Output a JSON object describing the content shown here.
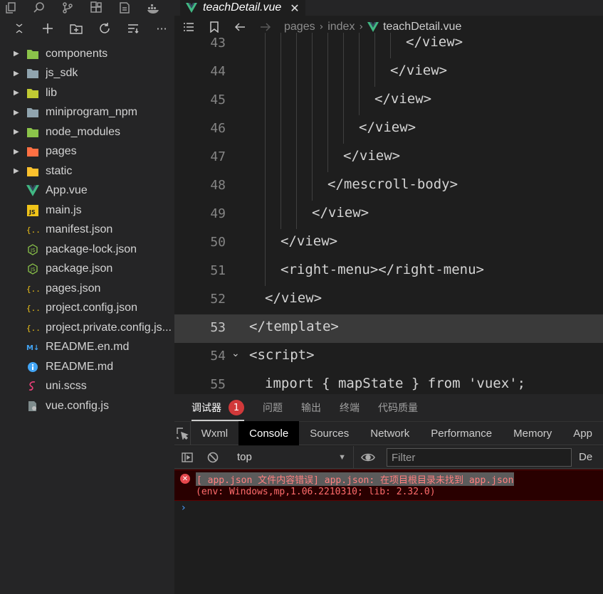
{
  "activity_bar": {
    "icons": [
      "files-icon",
      "search-icon",
      "source-control-icon",
      "extensions-icon",
      "page-icon",
      "docker-icon"
    ]
  },
  "explorer_toolbar": {
    "icons": [
      "collapse-icon",
      "new-file-icon",
      "new-folder-icon",
      "refresh-icon",
      "sort-icon",
      "more-icon"
    ],
    "more_label": "···"
  },
  "explorer": {
    "items": [
      {
        "label": "components",
        "type": "folder",
        "color": "#8bc34a"
      },
      {
        "label": "js_sdk",
        "type": "folder",
        "color": "#90a4ae"
      },
      {
        "label": "lib",
        "type": "folder",
        "color": "#c0ca33"
      },
      {
        "label": "miniprogram_npm",
        "type": "folder",
        "color": "#90a4ae"
      },
      {
        "label": "node_modules",
        "type": "folder",
        "color": "#8bc34a"
      },
      {
        "label": "pages",
        "type": "folder",
        "color": "#ff7043"
      },
      {
        "label": "static",
        "type": "folder",
        "color": "#fbc02d"
      },
      {
        "label": "App.vue",
        "type": "vue"
      },
      {
        "label": "main.js",
        "type": "js"
      },
      {
        "label": "manifest.json",
        "type": "json"
      },
      {
        "label": "package-lock.json",
        "type": "npm"
      },
      {
        "label": "package.json",
        "type": "npm"
      },
      {
        "label": "pages.json",
        "type": "json"
      },
      {
        "label": "project.config.json",
        "type": "json"
      },
      {
        "label": "project.private.config.js...",
        "type": "json"
      },
      {
        "label": "README.en.md",
        "type": "md"
      },
      {
        "label": "README.md",
        "type": "info"
      },
      {
        "label": "uni.scss",
        "type": "sass"
      },
      {
        "label": "vue.config.js",
        "type": "config"
      }
    ]
  },
  "tab": {
    "name": "teachDetail.vue",
    "close": "✕"
  },
  "breadcrumb": {
    "parts": [
      "pages",
      "index"
    ],
    "file": "teachDetail.vue",
    "sep": "›"
  },
  "code": {
    "lines": [
      {
        "num": "43",
        "text": "</view>",
        "indent": 10
      },
      {
        "num": "44",
        "text": "</view>",
        "indent": 9
      },
      {
        "num": "45",
        "text": "</view>",
        "indent": 8
      },
      {
        "num": "46",
        "text": "</view>",
        "indent": 7
      },
      {
        "num": "47",
        "text": "</view>",
        "indent": 6
      },
      {
        "num": "48",
        "text": "</mescroll-body>",
        "indent": 5
      },
      {
        "num": "49",
        "text": "</view>",
        "indent": 4
      },
      {
        "num": "50",
        "text": "</view>",
        "indent": 2
      },
      {
        "num": "51",
        "text": "<right-menu></right-menu>",
        "indent": 2
      },
      {
        "num": "52",
        "text": "</view>",
        "indent": 1
      },
      {
        "num": "53",
        "text": "</template>",
        "indent": 0,
        "current": true
      },
      {
        "num": "54",
        "text": "<script>",
        "indent": 0,
        "fold": true
      },
      {
        "num": "55",
        "text": "import { mapState } from 'vuex';",
        "indent": 1
      }
    ],
    "fold_icon": "⌄"
  },
  "devtools": {
    "tabs": [
      {
        "label": "调试器",
        "active": true,
        "badge": "1"
      },
      {
        "label": "问题"
      },
      {
        "label": "输出"
      },
      {
        "label": "终端"
      },
      {
        "label": "代码质量"
      }
    ],
    "panels": [
      "Wxml",
      "Console",
      "Sources",
      "Network",
      "Performance",
      "Memory",
      "App"
    ],
    "active_panel": "Console",
    "context": "top",
    "context_arrow": "▼",
    "filter_placeholder": "Filter",
    "levels_label": "De",
    "error": {
      "line1": "[ app.json 文件内容错误] app.json: 在项目根目录未找到 app.json",
      "line2": "(env: Windows,mp,1.06.2210310; lib: 2.32.0)",
      "icon": "✕"
    },
    "prompt": "›"
  }
}
